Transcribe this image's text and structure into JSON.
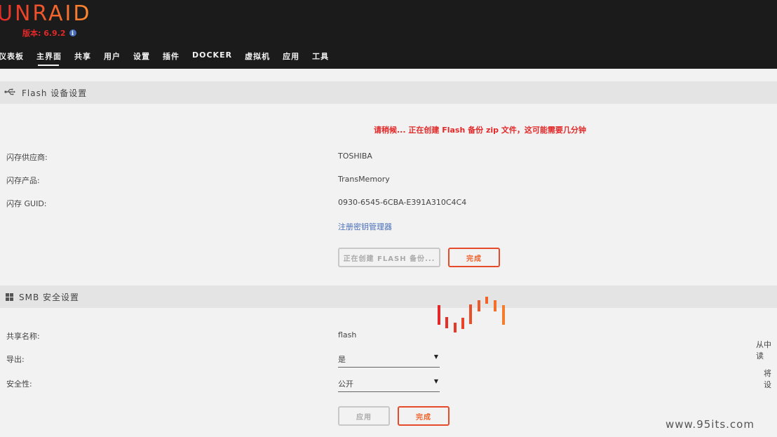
{
  "header": {
    "logo_text": "UNRAID",
    "version_label": "版本: 6.9.2",
    "info_icon": "info-icon",
    "nav": [
      {
        "label": "仪表板"
      },
      {
        "label": "主界面"
      },
      {
        "label": "共享"
      },
      {
        "label": "用户"
      },
      {
        "label": "设置"
      },
      {
        "label": "插件"
      },
      {
        "label": "DOCKER"
      },
      {
        "label": "虚拟机"
      },
      {
        "label": "应用"
      },
      {
        "label": "工具"
      }
    ],
    "active_nav": "主界面"
  },
  "flash_section": {
    "title": "Flash 设备设置",
    "icon": "usb-icon",
    "notice": "请稍候... 正在创建 Flash 备份 zip 文件，这可能需要几分钟",
    "fields": [
      {
        "label": "闪存供应商:",
        "value": "TOSHIBA"
      },
      {
        "label": "闪存产品:",
        "value": "TransMemory"
      },
      {
        "label": "闪存 GUID:",
        "value": "0930-6545-6CBA-E391A310C4C4"
      }
    ],
    "registration_link": "注册密钥管理器",
    "backup_button": "正在创建 FLASH 备份...",
    "done_button": "完成"
  },
  "smb_section": {
    "title": "SMB 安全设置",
    "icon": "windows-icon",
    "share_name_label": "共享名称:",
    "share_name_value": "flash",
    "export_label": "导出:",
    "export_value": "是",
    "security_label": "安全性:",
    "security_value": "公开",
    "apply_button": "应用",
    "done_button": "完成",
    "side_text_1": "从中读",
    "side_text_2": "将设"
  },
  "colors": {
    "accent_red": "#e22828",
    "accent_orange": "#f0622a",
    "link_blue": "#486dba",
    "header_bg": "#1c1b1b"
  },
  "watermark": "www.95its.com"
}
